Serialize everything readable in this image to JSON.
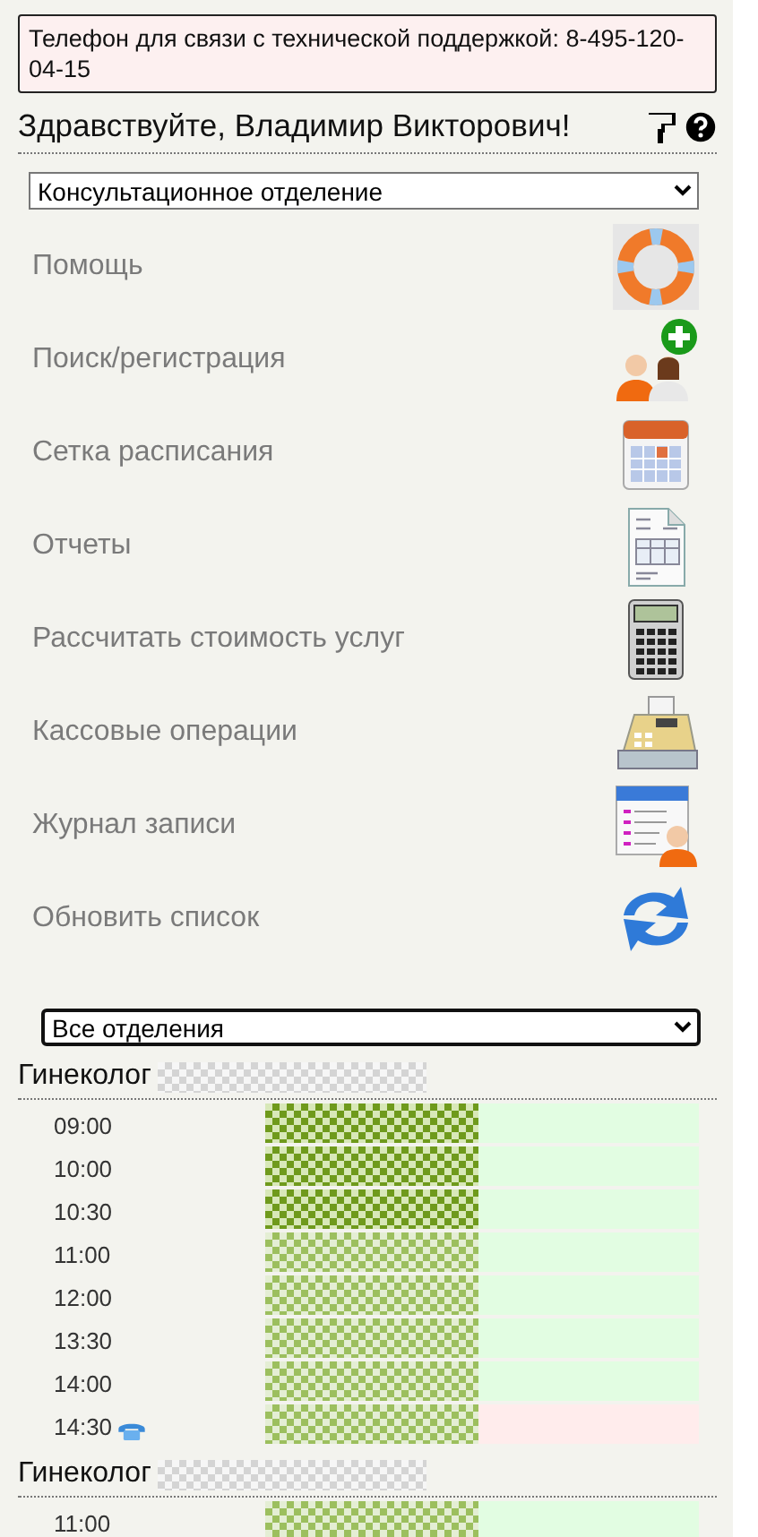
{
  "notice": "Телефон для связи с технической поддержкой: 8-495-120-04-15",
  "greeting": "Здравствуйте, Владимир Викторович!",
  "department_select": {
    "value": "Консультационное отделение"
  },
  "menu": [
    {
      "label": "Помощь",
      "kind": "lifebuoy"
    },
    {
      "label": "Поиск/регистрация",
      "kind": "people"
    },
    {
      "label": "Сетка расписания",
      "kind": "calendar"
    },
    {
      "label": "Отчеты",
      "kind": "document"
    },
    {
      "label": "Рассчитать стоимость услуг",
      "kind": "calculator"
    },
    {
      "label": "Кассовые операции",
      "kind": "register"
    },
    {
      "label": "Журнал записи",
      "kind": "journal"
    },
    {
      "label": "Обновить список",
      "kind": "refresh"
    }
  ],
  "filter_select": {
    "value": "Все отделения"
  },
  "doctors": [
    {
      "title": "Гинеколог",
      "slots": [
        {
          "time": "09:00",
          "phone": false,
          "emphasis": true,
          "color": "#e2fde2"
        },
        {
          "time": "10:00",
          "phone": false,
          "emphasis": true,
          "color": "#e2fde2"
        },
        {
          "time": "10:30",
          "phone": false,
          "emphasis": true,
          "color": "#e2fde2"
        },
        {
          "time": "11:00",
          "phone": false,
          "emphasis": false,
          "color": "#e2fde2"
        },
        {
          "time": "12:00",
          "phone": false,
          "emphasis": false,
          "color": "#e2fde2"
        },
        {
          "time": "13:30",
          "phone": false,
          "emphasis": false,
          "color": "#e2fde2"
        },
        {
          "time": "14:00",
          "phone": false,
          "emphasis": false,
          "color": "#e2fde2"
        },
        {
          "time": "14:30",
          "phone": true,
          "emphasis": false,
          "color": "#ffecec"
        }
      ]
    },
    {
      "title": "Гинеколог",
      "slots": [
        {
          "time": "11:00",
          "phone": false,
          "emphasis": false,
          "color": "#e2fde2"
        }
      ]
    }
  ]
}
